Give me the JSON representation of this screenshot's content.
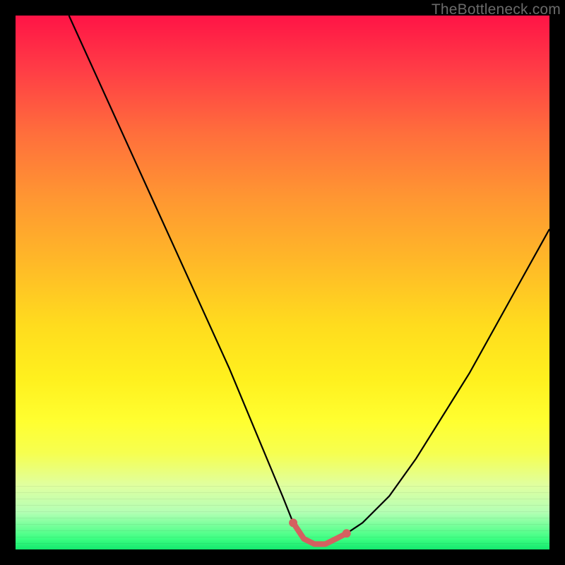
{
  "watermark": "TheBottleneck.com",
  "chart_data": {
    "type": "line",
    "title": "",
    "xlabel": "",
    "ylabel": "",
    "xlim": [
      0,
      100
    ],
    "ylim": [
      0,
      100
    ],
    "grid": false,
    "series": [
      {
        "name": "curve",
        "x": [
          10,
          15,
          20,
          25,
          30,
          35,
          40,
          45,
          50,
          52,
          54,
          56,
          58,
          60,
          62,
          65,
          70,
          75,
          80,
          85,
          90,
          95,
          100
        ],
        "y": [
          100,
          89,
          78,
          67,
          56,
          45,
          34,
          22,
          10,
          5,
          2,
          1,
          1,
          2,
          3,
          5,
          10,
          17,
          25,
          33,
          42,
          51,
          60
        ]
      }
    ],
    "highlight": {
      "name": "bottom-segment",
      "color": "#d46060",
      "x": [
        52,
        54,
        56,
        58,
        60,
        62
      ],
      "y": [
        5,
        2,
        1,
        1,
        2,
        3
      ]
    }
  },
  "colors": {
    "curve": "#000000",
    "highlight": "#d46060",
    "frame": "#000000"
  }
}
